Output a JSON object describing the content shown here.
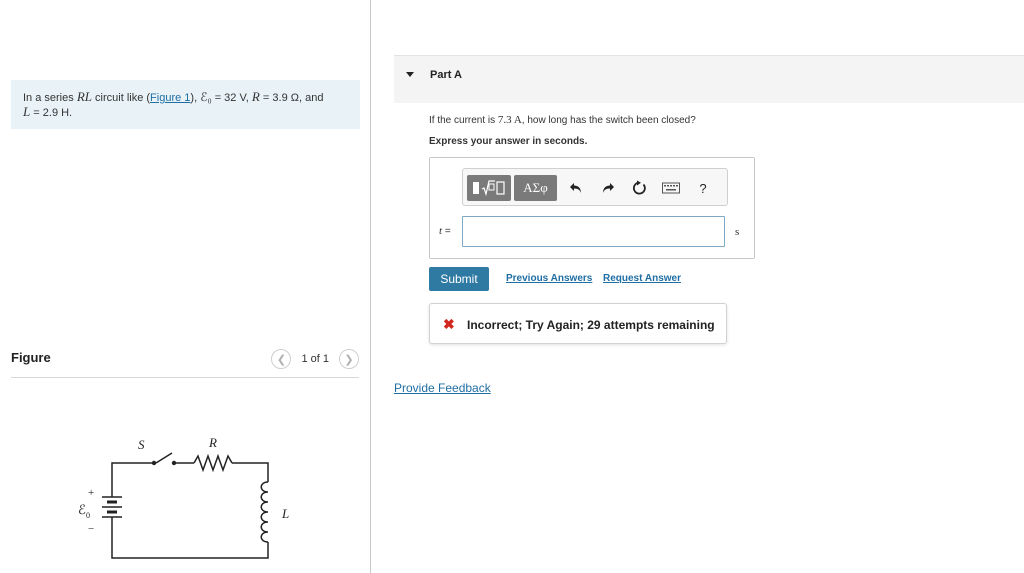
{
  "problem": {
    "prefix": "In a series ",
    "circuit_type": "RL",
    "mid1": " circuit like (",
    "figure_link": "Figure 1",
    "mid2": "), ",
    "emf_symbol": "ℰ₀",
    "emf_value": " = 32 V, ",
    "r_symbol": "R",
    "r_value": " = 3.9 Ω, and",
    "l_symbol": "L",
    "l_value": " = 2.9 H."
  },
  "figure": {
    "title": "Figure",
    "pager_text": "1 of 1",
    "prev_icon": "chevron-left",
    "next_icon": "chevron-right",
    "labels": {
      "switch": "S",
      "resistor": "R",
      "inductor": "L",
      "emf": "ℰ",
      "emf_sub": "0",
      "plus": "+",
      "minus": "−"
    }
  },
  "part": {
    "title": "Part A",
    "question_prefix": "If the current is ",
    "question_value": "7.3 A",
    "question_suffix": ", how long has the switch been closed?",
    "instruction": "Express your answer in seconds.",
    "toolbar": {
      "greek": "ΑΣφ",
      "help": "?",
      "icons": [
        "template-icon",
        "undo-icon",
        "redo-icon",
        "reset-icon",
        "keyboard-icon",
        "help-icon"
      ]
    },
    "variable": "t",
    "equals": " =",
    "answer_value": "",
    "unit": "s",
    "submit_label": "Submit",
    "previous_answers_label": "Previous Answers",
    "request_answer_label": "Request Answer",
    "feedback_icon": "✖",
    "feedback_text": "Incorrect; Try Again; 29 attempts remaining",
    "error_color": "#d0281e"
  },
  "provide_feedback_label": "Provide Feedback",
  "colors": {
    "accent": "#2f7aa3",
    "link": "#1f6ea3",
    "problem_bg": "#e9f3f7"
  }
}
